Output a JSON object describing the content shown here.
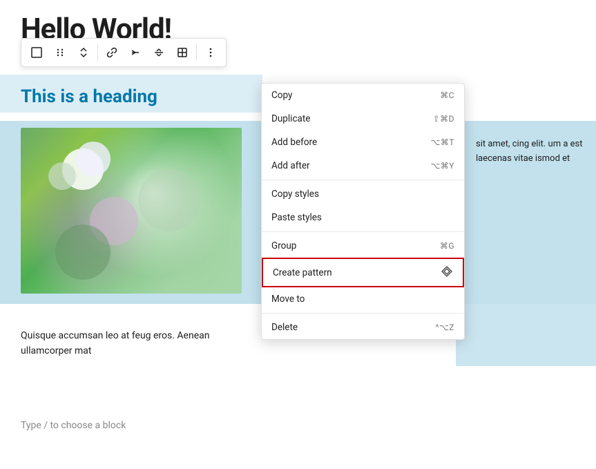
{
  "page": {
    "hello_world": "Hello World!",
    "heading": "This is a heading",
    "body_text": "sit amet, cing elit. um a est laecenas vitae ismod et",
    "bottom_paragraph": "Quisque accumsan leo at feug eros. Aenean ullamcorper mat",
    "placeholder": "Type / to choose a block"
  },
  "toolbar": {
    "buttons": [
      {
        "name": "select-icon",
        "icon": "⬜",
        "label": "Select"
      },
      {
        "name": "drag-icon",
        "icon": "⠿",
        "label": "Drag"
      },
      {
        "name": "move-up-down-icon",
        "icon": "⌃",
        "label": "Move up/down"
      },
      {
        "name": "link-icon",
        "icon": "🔗",
        "label": "Link"
      },
      {
        "name": "transform-icon",
        "icon": "⊣",
        "label": "Transform"
      },
      {
        "name": "align-icon",
        "icon": "⊢",
        "label": "Align"
      },
      {
        "name": "table-icon",
        "icon": "⊞",
        "label": "Table"
      },
      {
        "name": "more-icon",
        "icon": "⋮",
        "label": "More options"
      }
    ]
  },
  "context_menu": {
    "items": [
      {
        "id": "copy",
        "label": "Copy",
        "shortcut": "⌘C",
        "separator_after": false
      },
      {
        "id": "duplicate",
        "label": "Duplicate",
        "shortcut": "⇧⌘D",
        "separator_after": false
      },
      {
        "id": "add-before",
        "label": "Add before",
        "shortcut": "⌥⌘T",
        "separator_after": false
      },
      {
        "id": "add-after",
        "label": "Add after",
        "shortcut": "⌥⌘Y",
        "separator_after": true
      },
      {
        "id": "copy-styles",
        "label": "Copy styles",
        "shortcut": "",
        "separator_after": false
      },
      {
        "id": "paste-styles",
        "label": "Paste styles",
        "shortcut": "",
        "separator_after": true
      },
      {
        "id": "group",
        "label": "Group",
        "shortcut": "⌘G",
        "separator_after": false
      },
      {
        "id": "create-pattern",
        "label": "Create pattern",
        "shortcut": "◇",
        "highlighted": true,
        "separator_after": false
      },
      {
        "id": "move-to",
        "label": "Move to",
        "shortcut": "",
        "separator_after": true
      },
      {
        "id": "delete",
        "label": "Delete",
        "shortcut": "^⌥Z",
        "separator_after": false
      }
    ]
  }
}
